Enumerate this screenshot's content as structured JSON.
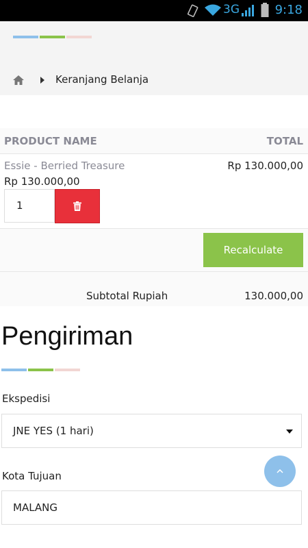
{
  "status_bar": {
    "network": "3G",
    "time": "9:18"
  },
  "breadcrumb": {
    "current": "Keranjang Belanja"
  },
  "accent_colors": {
    "blue": "#8ec0ea",
    "green": "#8bc34a",
    "pink": "#f2d6d3",
    "red": "#e8303a"
  },
  "cart": {
    "columns": [
      "PRODUCT NAME",
      "TOTAL"
    ],
    "items": [
      {
        "name": "Essie - Berried Treasure",
        "price": "Rp 130.000,00",
        "total": "Rp 130.000,00",
        "quantity": "1"
      }
    ],
    "recalculate_label": "Recalculate",
    "subtotal_label": "Subtotal Rupiah",
    "subtotal_value": "130.000,00"
  },
  "shipping": {
    "title": "Pengiriman",
    "courier_label": "Ekspedisi",
    "courier_value": "JNE YES (1 hari)",
    "city_label": "Kota Tujuan",
    "city_value": "MALANG"
  },
  "icons": [
    "home-icon",
    "chevron-right-icon",
    "trash-icon",
    "caret-down-icon",
    "arrow-up-icon"
  ]
}
